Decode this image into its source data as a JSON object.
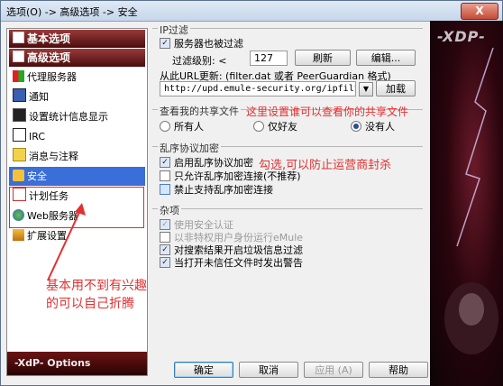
{
  "window": {
    "title": "选项(O) -> 高级选项 -> 安全",
    "close_label": "X"
  },
  "sidebar": {
    "headers": [
      "基本选项",
      "高级选项"
    ],
    "items": [
      {
        "label": "代理服务器",
        "icon": "proxy-icon"
      },
      {
        "label": "通知",
        "icon": "notify-icon"
      },
      {
        "label": "设置统计信息显示",
        "icon": "stats-icon"
      },
      {
        "label": "IRC",
        "icon": "irc-icon"
      },
      {
        "label": "消息与注释",
        "icon": "message-icon"
      },
      {
        "label": "安全",
        "icon": "lock-icon",
        "selected": true
      },
      {
        "label": "计划任务",
        "icon": "schedule-icon"
      },
      {
        "label": "Web服务器",
        "icon": "web-icon"
      },
      {
        "label": "扩展设置",
        "icon": "extend-icon"
      }
    ],
    "footer": "-XdP- Options"
  },
  "ipfilter": {
    "group_label": "IP过滤",
    "server_filter_label": "服务器也被过滤",
    "level_label": "过滤级别: <",
    "level_value": "127",
    "refresh_label": "刷新",
    "edit_label": "编辑...",
    "url_update_label": "从此URL更新: (filter.dat 或者 PeerGuardian 格式)",
    "url_value": "http://upd.emule-security.org/ipfilter.",
    "load_label": "加载"
  },
  "shared": {
    "group_label": "查看我的共享文件",
    "options": [
      "所有人",
      "仅好友",
      "没有人"
    ],
    "selected_index": 2,
    "annotation": "这里设置谁可以查看你的共享文件"
  },
  "obfuscation": {
    "group_label": "乱序协议加密",
    "items": [
      {
        "label": "启用乱序协议加密",
        "checked": true
      },
      {
        "label": "只允许乱序加密连接(不推荐)",
        "checked": false
      },
      {
        "label": "禁止支持乱序加密连接",
        "checked": false
      }
    ],
    "annotation": "勾选,可以防止运营商封杀"
  },
  "misc": {
    "group_label": "杂项",
    "items": [
      {
        "label": "使用安全认证",
        "checked": true,
        "disabled": true
      },
      {
        "label": "以非特权用户身份运行eMule",
        "checked": false,
        "disabled": true
      },
      {
        "label": "对搜索结果开启垃圾信息过滤",
        "checked": true,
        "disabled": false
      },
      {
        "label": "当打开未信任文件时发出警告",
        "checked": true,
        "disabled": false
      }
    ]
  },
  "sidebar_annotation": {
    "line1": "基本用不到有兴趣",
    "line2": "的可以自己折腾"
  },
  "buttons": {
    "ok": "确定",
    "cancel": "取消",
    "apply": "应用 (A)",
    "help": "帮助"
  },
  "deco": {
    "logo": "-XDP-"
  },
  "colors": {
    "annotation": "#e23030",
    "selection": "#3a6ed8",
    "header_dark_red": "#4a0d0d"
  }
}
